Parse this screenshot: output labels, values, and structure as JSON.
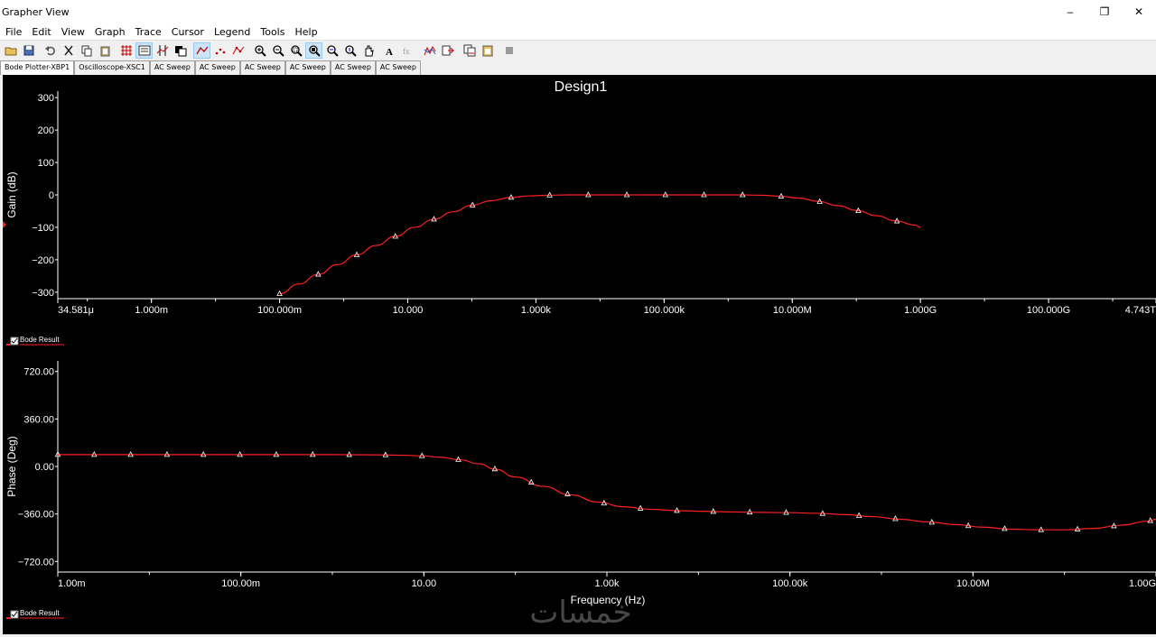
{
  "window": {
    "title": "Grapher View",
    "controls": [
      "–",
      "❐",
      "✕"
    ]
  },
  "menu": [
    "File",
    "Edit",
    "View",
    "Graph",
    "Trace",
    "Cursor",
    "Legend",
    "Tools",
    "Help"
  ],
  "toolbar": {
    "buttons": [
      {
        "name": "open-icon",
        "active": false
      },
      {
        "name": "save-icon",
        "active": false
      },
      {
        "name": "undo-icon",
        "active": false
      },
      {
        "name": "cut-icon",
        "active": false
      },
      {
        "name": "copy-icon",
        "active": false
      },
      {
        "name": "paste-icon",
        "active": false
      },
      {
        "name": "grid-icon",
        "active": false
      },
      {
        "name": "legend-icon",
        "active": true
      },
      {
        "name": "cursors-icon",
        "active": false
      },
      {
        "name": "overlay-icon",
        "active": false
      },
      {
        "name": "show-lines-icon",
        "active": true
      },
      {
        "name": "show-points-icon",
        "active": false
      },
      {
        "name": "lines-points-icon",
        "active": false
      },
      {
        "name": "zoom-in-icon",
        "active": false
      },
      {
        "name": "zoom-out-icon",
        "active": false
      },
      {
        "name": "zoom-area-icon",
        "active": false
      },
      {
        "name": "zoom-full-icon",
        "active": true
      },
      {
        "name": "zoom-x-icon",
        "active": false
      },
      {
        "name": "zoom-y-icon",
        "active": false
      },
      {
        "name": "pan-icon",
        "active": false
      },
      {
        "name": "text-icon",
        "active": false
      },
      {
        "name": "fx-icon",
        "active": false
      },
      {
        "name": "chart-props-icon",
        "active": false
      },
      {
        "name": "export-icon",
        "active": false
      },
      {
        "name": "copy-graph-icon",
        "active": false
      },
      {
        "name": "paste-graph-icon",
        "active": false
      },
      {
        "name": "stop-icon",
        "active": false
      }
    ]
  },
  "tabs": [
    "Bode Plotter-XBP1",
    "Oscilloscope-XSC1",
    "AC Sweep",
    "AC Sweep",
    "AC Sweep",
    "AC Sweep",
    "AC Sweep",
    "AC Sweep"
  ],
  "legend": {
    "top": "Bode Result",
    "bottom": "Bode Result"
  },
  "colors": {
    "background": "#000000",
    "trace": "#ff2020",
    "marker": "#ffffff",
    "axis_text": "#ffffff"
  },
  "watermark": "خمسات",
  "chart_data": [
    {
      "type": "line",
      "title": "Design1",
      "ylabel": "Gain (dB)",
      "xlabel": "",
      "xscale": "log",
      "ylim": [
        -320,
        320
      ],
      "yticks": [
        "300",
        "200",
        "100",
        "0",
        "−100",
        "−200",
        "−300"
      ],
      "ytick_values": [
        300,
        200,
        100,
        0,
        -100,
        -200,
        -300
      ],
      "xticks": [
        "34.581μ",
        "1.000m",
        "100.000m",
        "10.000",
        "1.000k",
        "100.000k",
        "10.000M",
        "1.000G",
        "100.000G",
        "4.743T"
      ],
      "xtick_values": [
        3.4581e-05,
        0.001,
        0.1,
        10,
        1000,
        100000,
        10000000,
        1000000000,
        100000000000,
        4743000000000
      ],
      "series": [
        {
          "name": "Bode Result",
          "x": [
            0.1,
            0.2,
            0.4,
            0.8,
            1.6,
            3.2,
            6.4,
            12.8,
            25.6,
            51.2,
            100,
            200,
            400,
            800,
            1600,
            3200,
            6400,
            12800,
            25600,
            51200,
            100000,
            200000,
            400000,
            800000,
            1600000,
            3200000,
            6400000,
            12800000,
            25600000,
            51200000,
            102400000,
            204800000,
            409600000,
            819200000,
            1000000000
          ],
          "y": [
            -305,
            -275,
            -245,
            -215,
            -185,
            -156,
            -128,
            -100,
            -75,
            -52,
            -32,
            -18,
            -8,
            -3,
            -1,
            0,
            0,
            0,
            0,
            0,
            0,
            0,
            0,
            0,
            0,
            -1,
            -4,
            -10,
            -20,
            -33,
            -48,
            -64,
            -80,
            -93,
            -100
          ]
        }
      ],
      "markers_x": [
        0.1,
        0.4,
        1.6,
        6.4,
        25.6,
        102.4,
        409.6,
        1638.4,
        6553.6,
        26214.4,
        104857.6,
        419430.4,
        1677721.6,
        6710886.4,
        26843545.6,
        107374182.4,
        429496729.6
      ]
    },
    {
      "type": "line",
      "title": "",
      "ylabel": "Phase (Deg)",
      "xlabel": "Frequency (Hz)",
      "xscale": "log",
      "ylim": [
        -800,
        800
      ],
      "yticks": [
        "720.00",
        "360.00",
        "0.00",
        "−360.00",
        "−720.00"
      ],
      "ytick_values": [
        720,
        360,
        0,
        -360,
        -720
      ],
      "xticks": [
        "1.00m",
        "100.00m",
        "10.00",
        "1.00k",
        "100.00k",
        "10.00M",
        "1.00G"
      ],
      "xtick_values": [
        0.001,
        0.1,
        10,
        1000,
        100000,
        10000000,
        1000000000
      ],
      "series": [
        {
          "name": "Bode Result",
          "x": [
            0.001,
            0.01,
            0.1,
            1,
            3,
            6,
            10,
            15,
            25,
            40,
            60,
            100,
            200,
            400,
            800,
            1500,
            3000,
            6000,
            12000,
            25000,
            50000,
            100000,
            200000,
            400000,
            800000,
            1600000,
            3200000,
            6400000,
            12800000,
            25600000,
            51200000,
            102400000,
            204800000,
            409600000,
            819200000,
            1000000000
          ],
          "y": [
            90,
            90,
            90,
            90,
            88,
            85,
            80,
            70,
            50,
            20,
            -20,
            -80,
            -150,
            -215,
            -270,
            -305,
            -325,
            -335,
            -340,
            -345,
            -348,
            -350,
            -355,
            -365,
            -380,
            -400,
            -420,
            -440,
            -460,
            -475,
            -480,
            -480,
            -470,
            -445,
            -415,
            -400
          ]
        }
      ],
      "markers_x": [
        0.001,
        0.0025,
        0.00625,
        0.0156,
        0.039,
        0.0977,
        0.244,
        0.61,
        1.53,
        3.81,
        9.54,
        23.8,
        59.6,
        149,
        372,
        931,
        2328,
        5821,
        14551,
        36380,
        90949,
        227374,
        568434,
        1421085,
        3552713,
        8881784,
        22204460,
        55511151,
        138777878,
        346944695,
        867361738
      ]
    }
  ]
}
